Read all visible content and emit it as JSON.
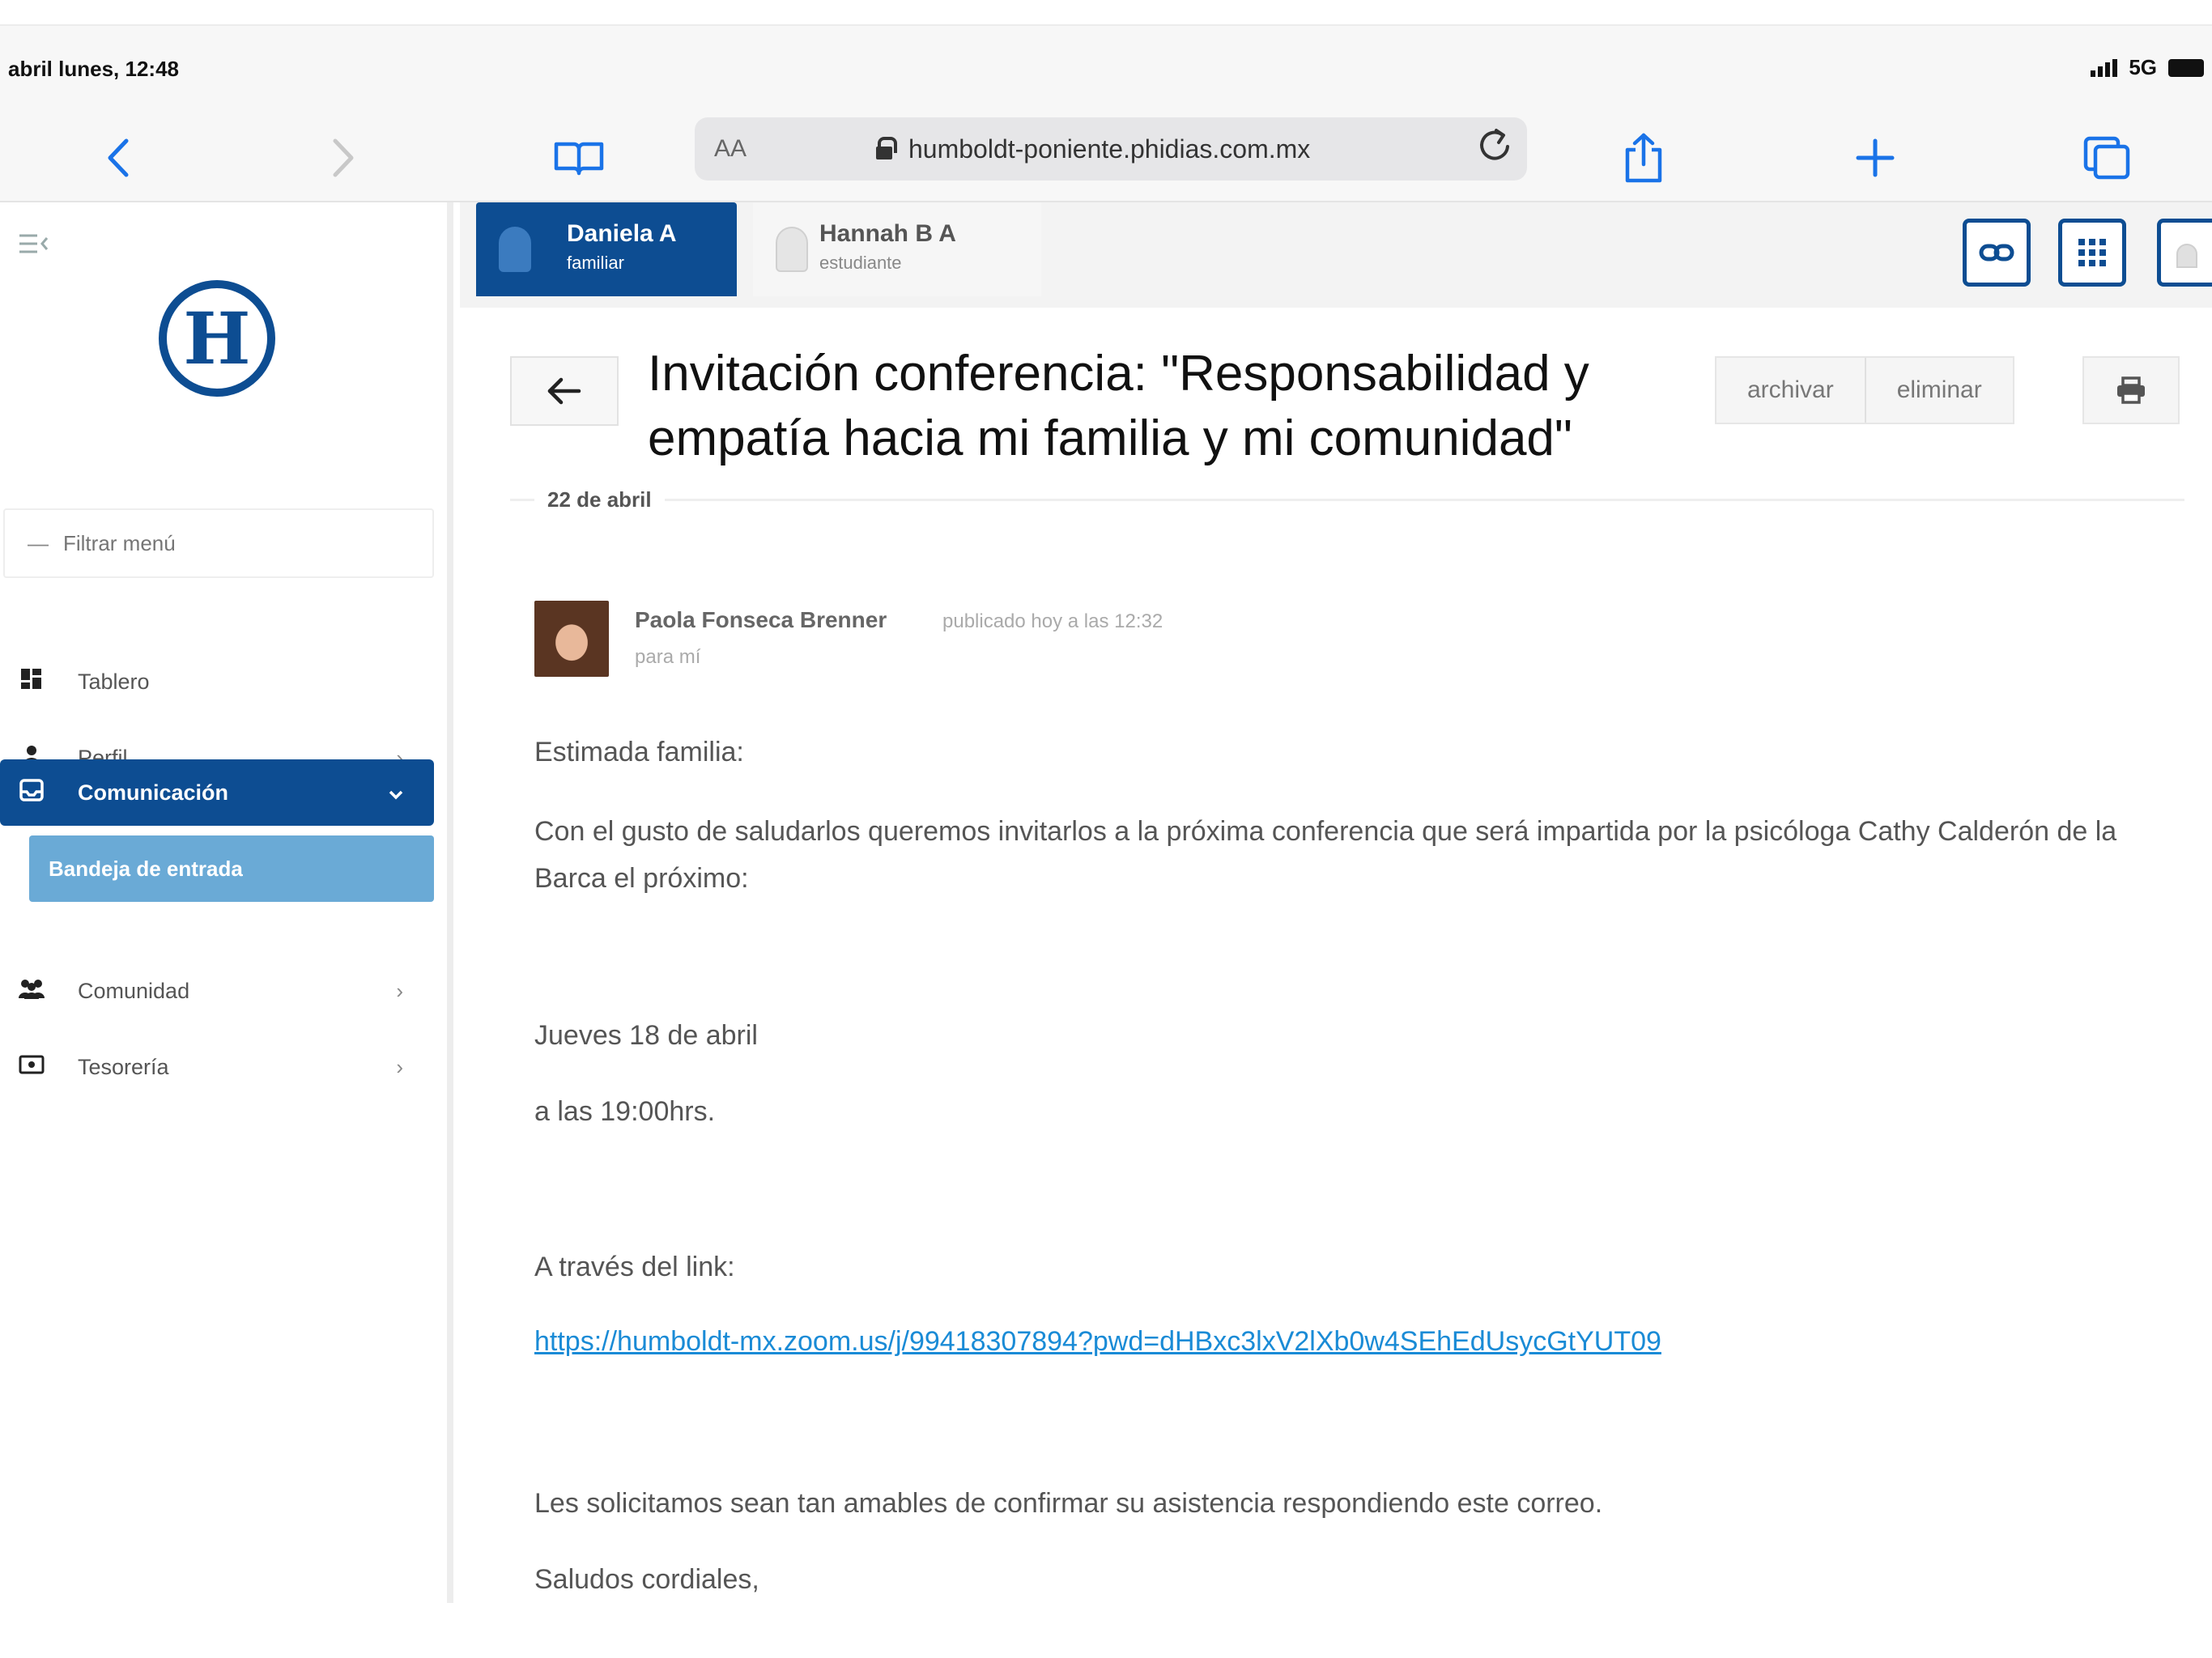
{
  "status_bar": {
    "time": "abril lunes, 12:48",
    "network": "5G"
  },
  "browser": {
    "text_size_label": "AA",
    "url": "humboldt-poniente.phidias.com.mx",
    "icons": [
      "chevron-left-icon",
      "chevron-right-icon",
      "book-icon",
      "lock-icon",
      "reload-icon",
      "share-icon",
      "plus-icon",
      "tabs-icon"
    ]
  },
  "sidebar": {
    "logo_letter": "H",
    "filter_placeholder": "Filtrar menú",
    "items": [
      {
        "label": "Tablero",
        "icon": "dashboard-icon"
      },
      {
        "label": "Perfil",
        "icon": "user-icon"
      },
      {
        "label": "Comunicación",
        "icon": "inbox-icon"
      },
      {
        "label": "Comunidad",
        "icon": "community-icon"
      },
      {
        "label": "Tesorería",
        "icon": "money-icon"
      }
    ],
    "sub_item": "Bandeja de entrada"
  },
  "profiles": [
    {
      "name": "Daniela A",
      "role": "familiar"
    },
    {
      "name": "Hannah B A",
      "role": "estudiante"
    }
  ],
  "message": {
    "title": "Invitación conferencia: \"Responsabilidad y empatía hacia mi familia y mi comunidad\"",
    "archive_label": "archivar",
    "delete_label": "eliminar",
    "date": "22 de abril",
    "sender": "Paola Fonseca Brenner",
    "published": "publicado hoy a las 12:32",
    "recipient": "para mí",
    "greeting": "Estimada familia:",
    "paragraph1": "Con el gusto de saludarlos queremos invitarlos a la próxima conferencia que será impartida por la psicóloga Cathy Calderón de la Barca el próximo:",
    "date_line": "Jueves 18 de abril",
    "time_line": "a las 19:00hrs.",
    "link_intro": "A través del link:",
    "link": "https://humboldt-mx.zoom.us/j/99418307894?pwd=dHBxc3lxV2lXb0w4SEhEdUsycGtYUT09",
    "confirm": "Les solicitamos sean tan amables de confirmar su asistencia respondiendo este correo.",
    "closing": "Saludos cordiales,"
  },
  "colors": {
    "brand": "#0d4d92",
    "submenu": "#6aaad6",
    "link": "#1a8bd6",
    "safari_blue": "#1a73e8"
  }
}
